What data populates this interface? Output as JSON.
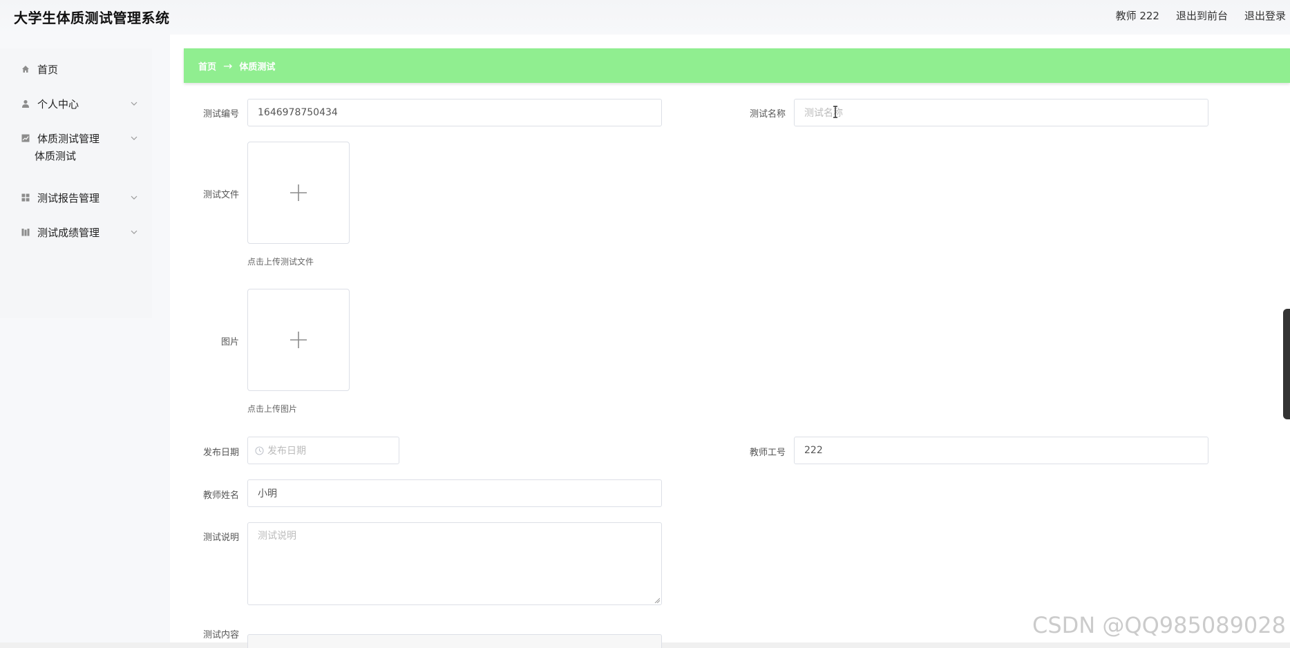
{
  "header": {
    "app_title": "大学生体质测试管理系统",
    "user_label": "教师 222",
    "exit_front": "退出到前台",
    "logout": "退出登录"
  },
  "sidebar": {
    "items": [
      {
        "label": "首页",
        "icon": "home-icon"
      },
      {
        "label": "个人中心",
        "icon": "user-icon"
      },
      {
        "label": "体质测试管理",
        "icon": "chart-icon"
      },
      {
        "label": "测试报告管理",
        "icon": "grid-icon"
      },
      {
        "label": "测试成绩管理",
        "icon": "book-icon"
      }
    ],
    "subitem": "体质测试"
  },
  "breadcrumb": {
    "home": "首页",
    "current": "体质测试"
  },
  "form": {
    "test_no_label": "测试编号",
    "test_no_value": "1646978750434",
    "test_name_label": "测试名称",
    "test_name_placeholder": "测试名称",
    "test_file_label": "测试文件",
    "test_file_hint": "点击上传测试文件",
    "image_label": "图片",
    "image_hint": "点击上传图片",
    "publish_date_label": "发布日期",
    "publish_date_placeholder": "发布日期",
    "teacher_id_label": "教师工号",
    "teacher_id_value": "222",
    "teacher_name_label": "教师姓名",
    "teacher_name_value": "小明",
    "desc_label": "测试说明",
    "desc_placeholder": "测试说明",
    "content_label": "测试内容"
  },
  "watermark": "CSDN @QQ985089028",
  "colors": {
    "breadcrumb_bg": "#90ee90",
    "page_bg": "#ffffff",
    "sidebar_bg": "#f7f8fa"
  }
}
